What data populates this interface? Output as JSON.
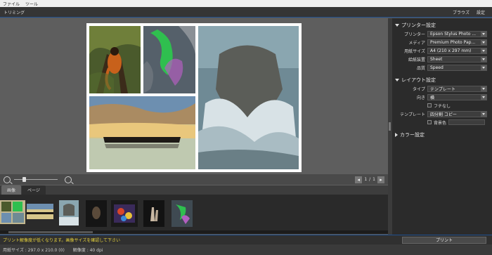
{
  "menu": {
    "file": "ファイル",
    "tools": "ツール"
  },
  "toolbar": {
    "mode": "トリミング",
    "browse": "ブラウズ",
    "settings": "設定"
  },
  "pager": {
    "current_page": "1",
    "separator": "/",
    "total_pages": "1",
    "prev_icon": "arrow-left-icon",
    "next_icon": "arrow-right-icon"
  },
  "filmstrip": {
    "tabs": [
      "画像",
      "ページ"
    ],
    "active_tab": "ページ"
  },
  "panel": {
    "printer_settings": {
      "title": "プリンター設定",
      "rows": [
        {
          "label": "プリンター",
          "value": "Epson Stylus Photo ..."
        },
        {
          "label": "メディア",
          "value": "Premium Photo Pap..."
        },
        {
          "label": "用紙サイズ",
          "value": "A4 (210 x 297 mm)"
        },
        {
          "label": "給紙装置",
          "value": "Sheet"
        },
        {
          "label": "品質",
          "value": "Speed"
        }
      ]
    },
    "layout_settings": {
      "title": "レイアウト設定",
      "type_label": "タイプ",
      "type_value": "テンプレート",
      "orientation_label": "向き",
      "orientation_value": "横",
      "borderless_label": "フチなし",
      "template_label": "テンプレート",
      "template_value": "四分割 コピー",
      "background_label": "背景色"
    },
    "color_settings": {
      "title": "カラー設定"
    }
  },
  "status": {
    "warning": "プリント解像度が低くなります。画像サイズを確認して下さい",
    "print_button": "プリント",
    "paper_size": "用紙サイズ : 297.0 x 210.0 (0)",
    "resolution": "解像度 : 40 dpi"
  },
  "colors": {
    "accent": "#1f4f8f",
    "warning_text": "#e6d23d",
    "panel_bg": "#2b2b2b",
    "canvas_bg": "#5e5e5e"
  }
}
